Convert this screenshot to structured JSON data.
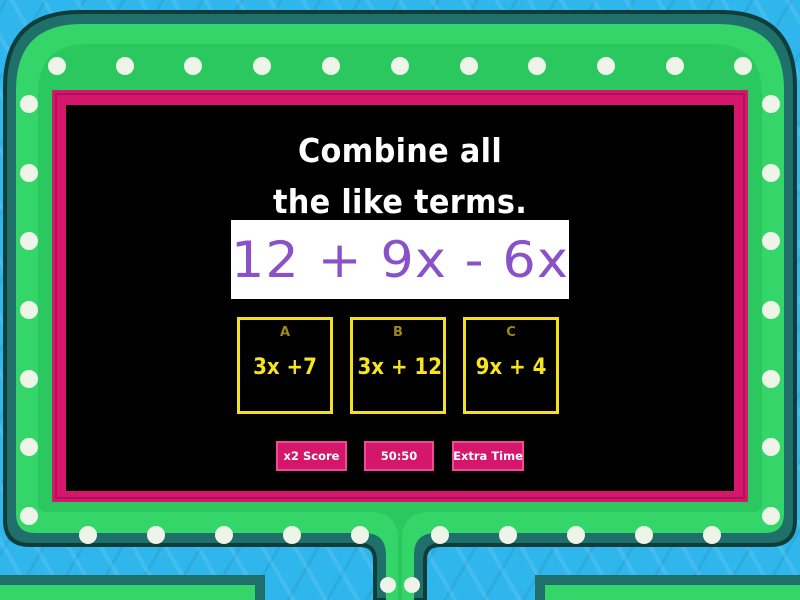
{
  "question": {
    "line1": "Combine all",
    "line2": "the like terms.",
    "expression": "12 + 9x - 6x"
  },
  "answers": [
    {
      "letter": "A",
      "text": "3x +7"
    },
    {
      "letter": "B",
      "text": "3x + 12"
    },
    {
      "letter": "C",
      "text": "9x + 4"
    }
  ],
  "powerups": {
    "double_score": "x2 Score",
    "fifty_fifty": "50:50",
    "extra_time": "Extra Time"
  },
  "colors": {
    "background": "#2fb6ec",
    "frame_dark": "#1f6f6a",
    "frame_green": "#34d66a",
    "screen_border": "#d4176b",
    "answer_border": "#f4e020",
    "expression_text": "#8a52c9"
  },
  "icons": [
    "marquee-light-icon"
  ]
}
